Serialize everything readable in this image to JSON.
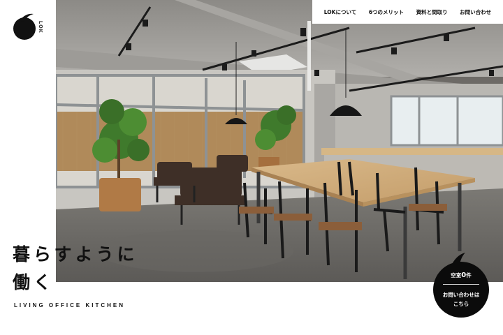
{
  "brand": {
    "logo_text": "LOK",
    "logo_numeral": "6"
  },
  "nav": {
    "items": [
      {
        "label": "LOKについて"
      },
      {
        "label": "6つのメリット"
      },
      {
        "label": "資料と間取り"
      },
      {
        "label": "お問い合わせ"
      }
    ]
  },
  "hero": {
    "headline_line1": "暮らすように",
    "headline_line2": "働く",
    "tagline": "LIVING OFFICE KITCHEN"
  },
  "badge": {
    "vacancy_prefix": "空室",
    "vacancy_count": "0",
    "vacancy_unit": "件",
    "cta_line1": "お問い合わせは",
    "cta_line2": "こちら"
  },
  "colors": {
    "ink": "#111111",
    "badge": "#0b0b0b",
    "background": "#ffffff"
  }
}
